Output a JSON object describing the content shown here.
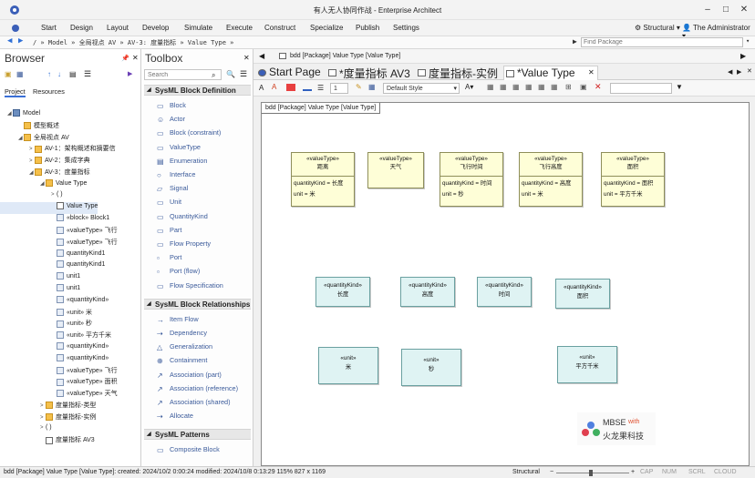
{
  "window": {
    "title": "有人无人协同作战 - Enterprise Architect"
  },
  "menu": {
    "items": [
      "Start",
      "Design",
      "Layout",
      "Develop",
      "Simulate",
      "Execute",
      "Construct",
      "Specialize",
      "Publish",
      "Settings"
    ],
    "workspace": "Structural",
    "user": "The Administrator"
  },
  "nav": {
    "path": "/   » Model » 全局视点 AV » AV-3: 度量指标  » Value Type »",
    "tab_path": "bdd [Package] Value Type [Value Type]",
    "find_placeholder": "Find Package"
  },
  "browser": {
    "title": "Browser",
    "tabs": [
      "Project",
      "Resources"
    ],
    "tree": [
      {
        "label": "Model",
        "level": 0,
        "arrow": "◢",
        "icon": "model"
      },
      {
        "label": "模型概述",
        "level": 1,
        "arrow": "",
        "icon": "pkg"
      },
      {
        "label": "全局视点 AV",
        "level": 1,
        "arrow": "◢",
        "icon": "pkg"
      },
      {
        "label": "AV-1：架构概述和摘要信",
        "level": 2,
        "arrow": ">",
        "icon": "pkg"
      },
      {
        "label": "AV-2：集成字典",
        "level": 2,
        "arrow": ">",
        "icon": "pkg"
      },
      {
        "label": "AV-3：度量指标",
        "level": 2,
        "arrow": "◢",
        "icon": "pkg"
      },
      {
        "label": "Value Type",
        "level": 3,
        "arrow": "◢",
        "icon": "pkg"
      },
      {
        "label": "( )",
        "level": 4,
        "arrow": ">",
        "icon": "none"
      },
      {
        "label": "Value Type",
        "level": 4,
        "arrow": "",
        "icon": "diag"
      },
      {
        "label": "«block» Block1",
        "level": 4,
        "arrow": "",
        "icon": "el"
      },
      {
        "label": "«valueType» 飞行",
        "level": 4,
        "arrow": "",
        "icon": "el"
      },
      {
        "label": "«valueType» 飞行",
        "level": 4,
        "arrow": "",
        "icon": "el"
      },
      {
        "label": "quantityKind1",
        "level": 4,
        "arrow": "",
        "icon": "el"
      },
      {
        "label": "quantityKind1",
        "level": 4,
        "arrow": "",
        "icon": "el"
      },
      {
        "label": "unit1",
        "level": 4,
        "arrow": "",
        "icon": "el"
      },
      {
        "label": "unit1",
        "level": 4,
        "arrow": "",
        "icon": "el"
      },
      {
        "label": "«quantityKind»",
        "level": 4,
        "arrow": "",
        "icon": "el"
      },
      {
        "label": "«unit» 米",
        "level": 4,
        "arrow": "",
        "icon": "el"
      },
      {
        "label": "«unit» 秒",
        "level": 4,
        "arrow": "",
        "icon": "el"
      },
      {
        "label": "«unit» 平方千米",
        "level": 4,
        "arrow": "",
        "icon": "el"
      },
      {
        "label": "«quantityKind»",
        "level": 4,
        "arrow": "",
        "icon": "el"
      },
      {
        "label": "«quantityKind»",
        "level": 4,
        "arrow": "",
        "icon": "el"
      },
      {
        "label": "«valueType» 飞行",
        "level": 4,
        "arrow": "",
        "icon": "el"
      },
      {
        "label": "«valueType» 面积",
        "level": 4,
        "arrow": "",
        "icon": "el"
      },
      {
        "label": "«valueType» 天气",
        "level": 4,
        "arrow": "",
        "icon": "el"
      },
      {
        "label": "度量指标-类型",
        "level": 3,
        "arrow": ">",
        "icon": "pkg"
      },
      {
        "label": "度量指标-实例",
        "level": 3,
        "arrow": ">",
        "icon": "pkg"
      },
      {
        "label": "( )",
        "level": 3,
        "arrow": ">",
        "icon": "none"
      },
      {
        "label": "度量指标 AV3",
        "level": 3,
        "arrow": "",
        "icon": "diag"
      }
    ]
  },
  "toolbox": {
    "title": "Toolbox",
    "search_placeholder": "Search",
    "sections": [
      {
        "header": "SysML Block Definition",
        "items": [
          "Block",
          "Actor",
          "Block (constraint)",
          "ValueType",
          "Enumeration",
          "Interface",
          "Signal",
          "Unit",
          "QuantityKind",
          "Part",
          "Flow Property",
          "Port",
          "Port (flow)",
          "Flow Specification"
        ]
      },
      {
        "header": "SysML Block Relationships",
        "items": [
          "Item Flow",
          "Dependency",
          "Generalization",
          "Containment",
          "Association (part)",
          "Association (reference)",
          "Association (shared)",
          "Allocate"
        ]
      },
      {
        "header": "SysML Patterns",
        "items": [
          "Composite Block"
        ]
      }
    ]
  },
  "tabs": [
    {
      "label": "Start Page",
      "active": false
    },
    {
      "label": "*度量指标 AV3",
      "active": false
    },
    {
      "label": "度量指标-实例",
      "active": false
    },
    {
      "label": "*Value Type",
      "active": true
    }
  ],
  "diagram_toolbar": {
    "zoom_value": "1",
    "style_value": "Default Style"
  },
  "diagram": {
    "frame_label": "bdd [Package] Value Type [Value Type]",
    "value_types": [
      {
        "stereotype": "«valueType»",
        "name": "距离",
        "attrs": [
          "quantityKind = 长度",
          "unit = 米"
        ]
      },
      {
        "stereotype": "«valueType»",
        "name": "天气",
        "attrs": []
      },
      {
        "stereotype": "«valueType»",
        "name": "飞行时间",
        "attrs": [
          "quantityKind = 时间",
          "unit = 秒"
        ]
      },
      {
        "stereotype": "«valueType»",
        "name": "飞行高度",
        "attrs": [
          "quantityKind = 高度",
          "unit = 米"
        ]
      },
      {
        "stereotype": "«valueType»",
        "name": "面积",
        "attrs": [
          "quantityKind = 面积",
          "unit = 平方千米"
        ]
      }
    ],
    "quantity_kinds": [
      {
        "stereotype": "«quantityKind»",
        "name": "长度"
      },
      {
        "stereotype": "«quantityKind»",
        "name": "高度"
      },
      {
        "stereotype": "«quantityKind»",
        "name": "时间"
      },
      {
        "stereotype": "«quantityKind»",
        "name": "面积"
      }
    ],
    "units": [
      {
        "stereotype": "«unit»",
        "name": "米"
      },
      {
        "stereotype": "«unit»",
        "name": "秒"
      },
      {
        "stereotype": "«unit»",
        "name": "平方千米"
      }
    ],
    "watermark": {
      "text_top": "MBSE",
      "text_with": "with",
      "text_bottom": "火龙果科技"
    }
  },
  "statusbar": {
    "left": "bdd [Package] Value Type [Value Type]:   created: 2024/10/2 0:00:24  modified: 2024/10/8 0:13:29   115%   827 x 1169",
    "workspace": "Structural",
    "indicators": [
      "CAP",
      "NUM",
      "SCRL",
      "CLOUD"
    ]
  },
  "colors": {
    "value_type_fill": "#fefed7",
    "quantity_kind_fill": "#dff3f3",
    "accent": "#3a5a9a"
  }
}
